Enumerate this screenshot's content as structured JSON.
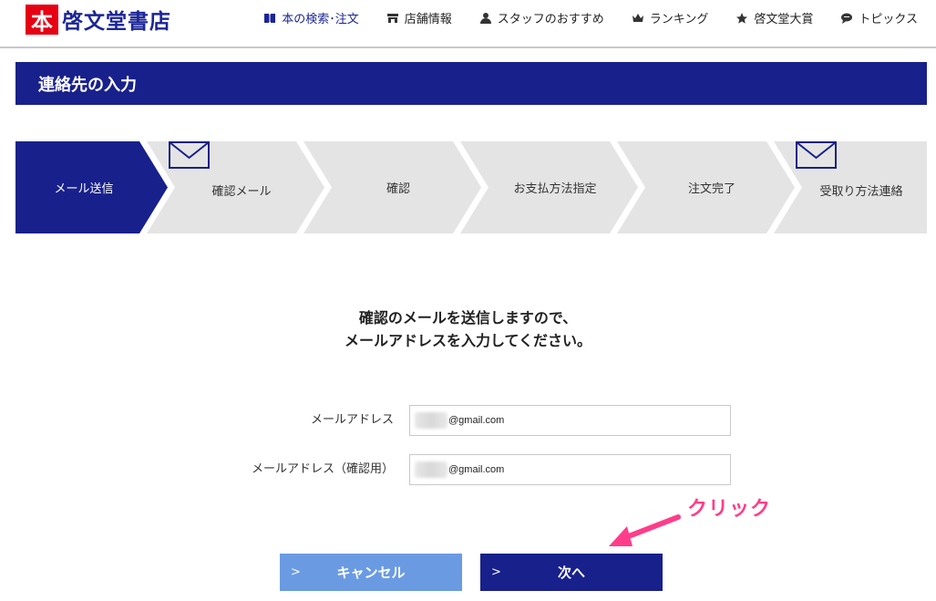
{
  "logo": {
    "mark": "本",
    "name": "啓文堂書店"
  },
  "nav": [
    {
      "label": "本の検索･注文",
      "icon": "book-icon",
      "active": true
    },
    {
      "label": "店舗情報",
      "icon": "store-icon"
    },
    {
      "label": "スタッフのおすすめ",
      "icon": "person-icon"
    },
    {
      "label": "ランキング",
      "icon": "crown-icon"
    },
    {
      "label": "啓文堂大賞",
      "icon": "star-icon"
    },
    {
      "label": "トピックス",
      "icon": "chat-bubble-icon"
    }
  ],
  "page_title": "連絡先の入力",
  "steps": [
    {
      "label": "メール送信",
      "active": true
    },
    {
      "label": "確認メール",
      "icon": "mail-icon"
    },
    {
      "label": "確認"
    },
    {
      "label": "お支払方法指定"
    },
    {
      "label": "注文完了"
    },
    {
      "label": "受取り方法連絡",
      "icon": "mail-icon"
    }
  ],
  "message": {
    "line1": "確認のメールを送信しますので、",
    "line2": "メールアドレスを入力してください。"
  },
  "form": {
    "email_label": "メールアドレス",
    "email_value": "@gmail.com",
    "confirm_label": "メールアドレス（確認用）",
    "confirm_value": "@gmail.com"
  },
  "buttons": {
    "cancel": "キャンセル",
    "next": "次へ"
  },
  "annotation": {
    "text": "クリック"
  },
  "colors": {
    "brand_navy": "#18208b",
    "logo_red": "#e60012",
    "cancel_blue": "#6a9be2",
    "step_gray": "#e4e4e4",
    "annotation_pink": "#ff3d8a"
  }
}
